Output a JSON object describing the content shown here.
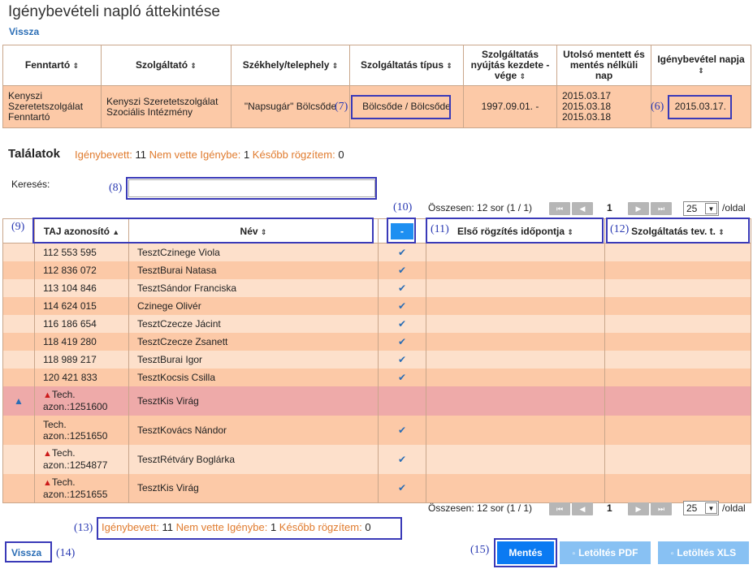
{
  "page": {
    "title": "Igénybevételi napló áttekintése",
    "back_link": "Vissza"
  },
  "provider_table": {
    "headers": [
      "Fenntartó",
      "Szolgáltató",
      "Székhely/telephely",
      "Szolgáltatás típus",
      "Szolgáltatás nyújtás kezdete - vége",
      "Utolsó mentett és mentés nélküli nap",
      "Igénybevétel napja"
    ],
    "row": {
      "fenntarto": "Kenyszi Szeretetszolgálat Fenntartó",
      "szolgaltato": "Kenyszi Szeretetszolgálat Szociális Intézmény",
      "szekhely": "\"Napsugár\" Bölcsőde",
      "tipus": "Bölcsőde / Bölcsőde",
      "kezdete": "1997.09.01. -",
      "utolso": [
        "2015.03.17",
        "2015.03.18",
        "2015.03.18"
      ],
      "napja": "2015.03.17."
    }
  },
  "results": {
    "title": "Találatok",
    "counts": {
      "igenybevett_label": "Igénybevett:",
      "igenybevett": "11",
      "nem_vette_label": "Nem vette Igénybe:",
      "nem_vette": "1",
      "kesobb_label": "Később rögzítem:",
      "kesobb": "0"
    },
    "search_label": "Keresés:",
    "search_value": ""
  },
  "pager": {
    "summary": "Összesen: 12 sor (1 / 1)",
    "page": "1",
    "per_page": "25",
    "per_page_suffix": "/oldal",
    "first_icon": "⏮",
    "prev_icon": "◀",
    "next_icon": "▶",
    "last_icon": "⏭"
  },
  "grid": {
    "headers": {
      "taj": "TAJ azonosító",
      "nev": "Név",
      "toggle": "-",
      "elso": "Első rögzítés időpontja",
      "tev": "Szolgáltatás tev. t."
    },
    "rows": [
      {
        "taj": "112 553 595",
        "nev": "TesztCzinege Viola",
        "checked": true,
        "warn": false,
        "info": false
      },
      {
        "taj": "112 836 072",
        "nev": "TesztBurai Natasa",
        "checked": true,
        "warn": false,
        "info": false
      },
      {
        "taj": "113 104 846",
        "nev": "TesztSándor Franciska",
        "checked": true,
        "warn": false,
        "info": false
      },
      {
        "taj": "114 624 015",
        "nev": "Czinege Olivér",
        "checked": true,
        "warn": false,
        "info": false
      },
      {
        "taj": "116 186 654",
        "nev": "TesztCzecze Jácint",
        "checked": true,
        "warn": false,
        "info": false
      },
      {
        "taj": "118 419 280",
        "nev": "TesztCzecze Zsanett",
        "checked": true,
        "warn": false,
        "info": false
      },
      {
        "taj": "118 989 217",
        "nev": "TesztBurai Igor",
        "checked": true,
        "warn": false,
        "info": false
      },
      {
        "taj": "120 421 833",
        "nev": "TesztKocsis Csilla",
        "checked": true,
        "warn": false,
        "info": false
      },
      {
        "taj_line1": "Tech.",
        "taj_line2": "azon.:1251600",
        "nev": "TesztKis Virág",
        "checked": false,
        "warn": true,
        "info": true
      },
      {
        "taj_line1": "Tech.",
        "taj_line2": "azon.:1251650",
        "nev": "TesztKovács Nándor",
        "checked": true,
        "warn": false,
        "info": false
      },
      {
        "taj_line1": "Tech.",
        "taj_line2": "azon.:1254877",
        "nev": "TesztRétváry Boglárka",
        "checked": true,
        "warn": true,
        "info": false
      },
      {
        "taj_line1": "Tech.",
        "taj_line2": "azon.:1251655",
        "nev": "TesztKis Virág",
        "checked": true,
        "warn": true,
        "info": false
      }
    ]
  },
  "buttons": {
    "back": "Vissza",
    "save": "Mentés",
    "pdf": "Letöltés PDF",
    "xls": "Letöltés XLS"
  },
  "annotations": {
    "a6": "(6)",
    "a7": "(7)",
    "a8": "(8)",
    "a9": "(9)",
    "a10": "(10)",
    "a11": "(11)",
    "a12": "(12)",
    "a13": "(13)",
    "a14": "(14)",
    "a15": "(15)"
  },
  "icons": {
    "sort": "sort-icon",
    "sort_up": "sort-asc-icon",
    "check": "check-icon",
    "warning": "warning-icon",
    "info": "info-icon",
    "document": "document-icon"
  },
  "colors": {
    "row_light": "#fde0cb",
    "row_dark": "#fcc9a7",
    "row_alert": "#eeaaa9",
    "accent_orange": "#e07b2e",
    "primary_blue": "#0a7af2",
    "annotation_blue": "#2a3ab3"
  }
}
